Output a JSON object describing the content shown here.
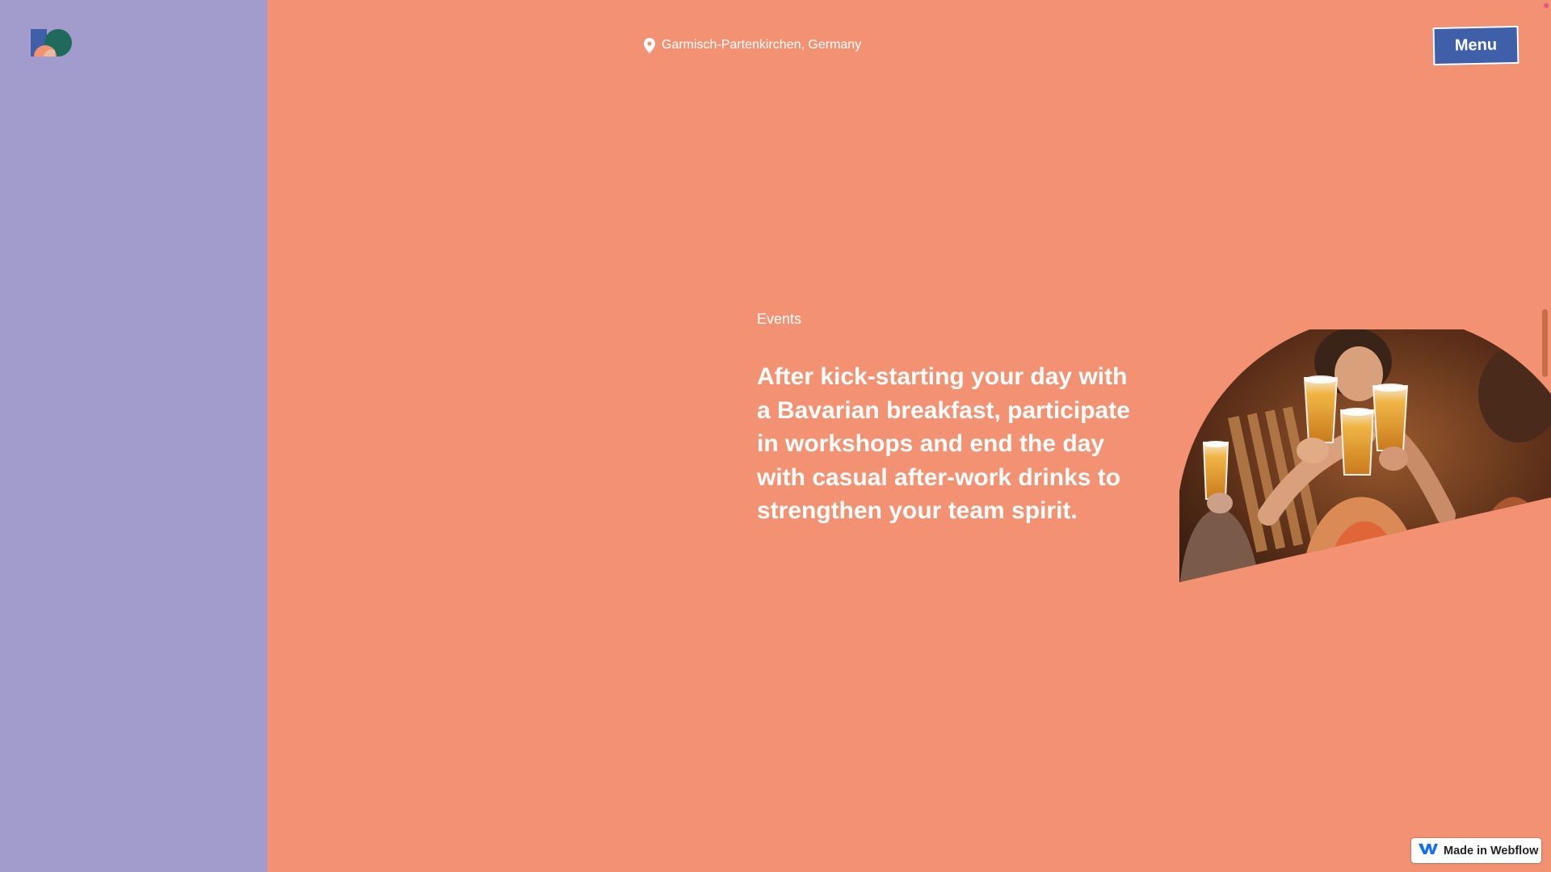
{
  "header": {
    "location": "Garmisch-Partenkirchen, Germany",
    "location_icon": "map-pin-icon",
    "menu_label": "Menu"
  },
  "logo": {
    "icon": "brand-logo",
    "colors": [
      "#3f5fa9",
      "#1e6b5b",
      "#f29272"
    ]
  },
  "section": {
    "eyebrow": "Events",
    "headline": "After kick-starting your day with a Bavarian breakfast, participate in workshops and end the day with casual after-work drinks to strengthen your team spirit."
  },
  "badge": {
    "label": "Made in Webflow",
    "icon": "webflow-icon"
  },
  "colors": {
    "background": "#f29272",
    "sidebar": "#a19ccc",
    "menu_button": "#3f5fa9",
    "text": "#ffffff"
  }
}
